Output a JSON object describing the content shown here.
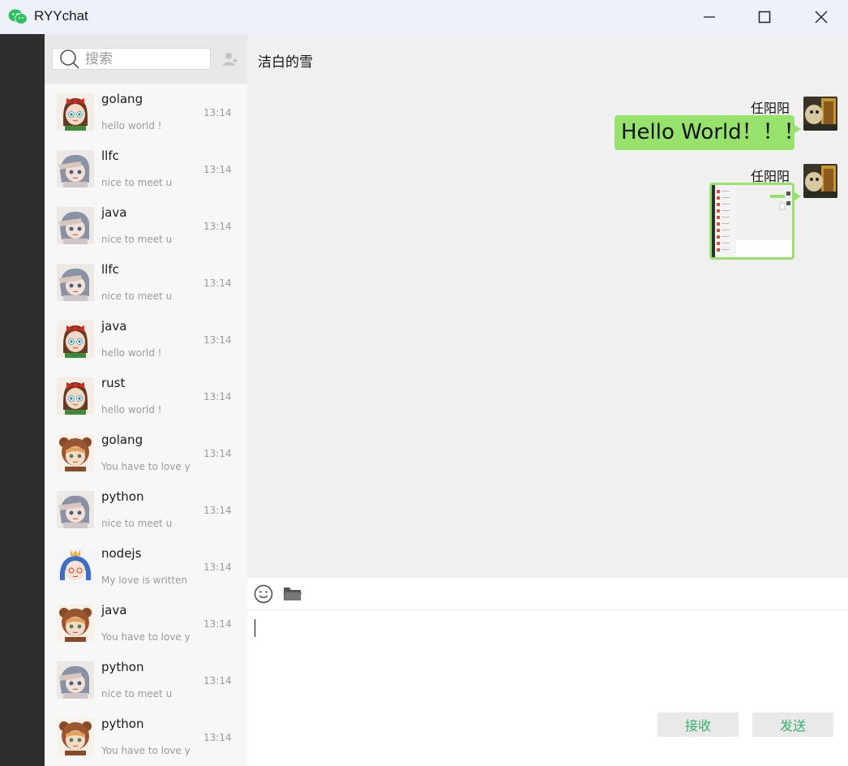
{
  "app": {
    "title": "RYYchat",
    "icon": "wechat-style-chat-icon",
    "accent": "#2dc162"
  },
  "search": {
    "placeholder": "搜索"
  },
  "contacts": [
    {
      "name": "golang",
      "preview": "hello world !",
      "time": "13:14",
      "avatar": "girl-red-bow"
    },
    {
      "name": "llfc",
      "preview": "nice to meet u",
      "time": "13:14",
      "avatar": "girl-salute"
    },
    {
      "name": "java",
      "preview": "nice to meet u",
      "time": "13:14",
      "avatar": "girl-salute"
    },
    {
      "name": "llfc",
      "preview": "nice to meet u",
      "time": "13:14",
      "avatar": "girl-salute"
    },
    {
      "name": "java",
      "preview": "hello world !",
      "time": "13:14",
      "avatar": "girl-red-bow"
    },
    {
      "name": "rust",
      "preview": "hello world !",
      "time": "13:14",
      "avatar": "girl-red-bow"
    },
    {
      "name": "golang",
      "preview": "You have to love yo",
      "time": "13:14",
      "avatar": "girl-bear-hood"
    },
    {
      "name": "python",
      "preview": "nice to meet u",
      "time": "13:14",
      "avatar": "girl-salute"
    },
    {
      "name": "nodejs",
      "preview": "My love is written i",
      "time": "13:14",
      "avatar": "girl-blue-crown"
    },
    {
      "name": "java",
      "preview": "You have to love yo",
      "time": "13:14",
      "avatar": "girl-bear-hood"
    },
    {
      "name": "python",
      "preview": "nice to meet u",
      "time": "13:14",
      "avatar": "girl-salute"
    },
    {
      "name": "python",
      "preview": "You have to love yo",
      "time": "13:14",
      "avatar": "girl-bear-hood"
    }
  ],
  "chat": {
    "title": "洁白的雪",
    "messages": [
      {
        "sender": "任阳阳",
        "type": "text",
        "text": "Hello World！！！"
      },
      {
        "sender": "任阳阳",
        "type": "image",
        "text": ""
      }
    ]
  },
  "composer": {
    "receive_label": "接收",
    "send_label": "发送"
  },
  "colors": {
    "sidebar": "#2e2e2e",
    "bubble": "#96e26c",
    "button_text": "#38b26a"
  }
}
